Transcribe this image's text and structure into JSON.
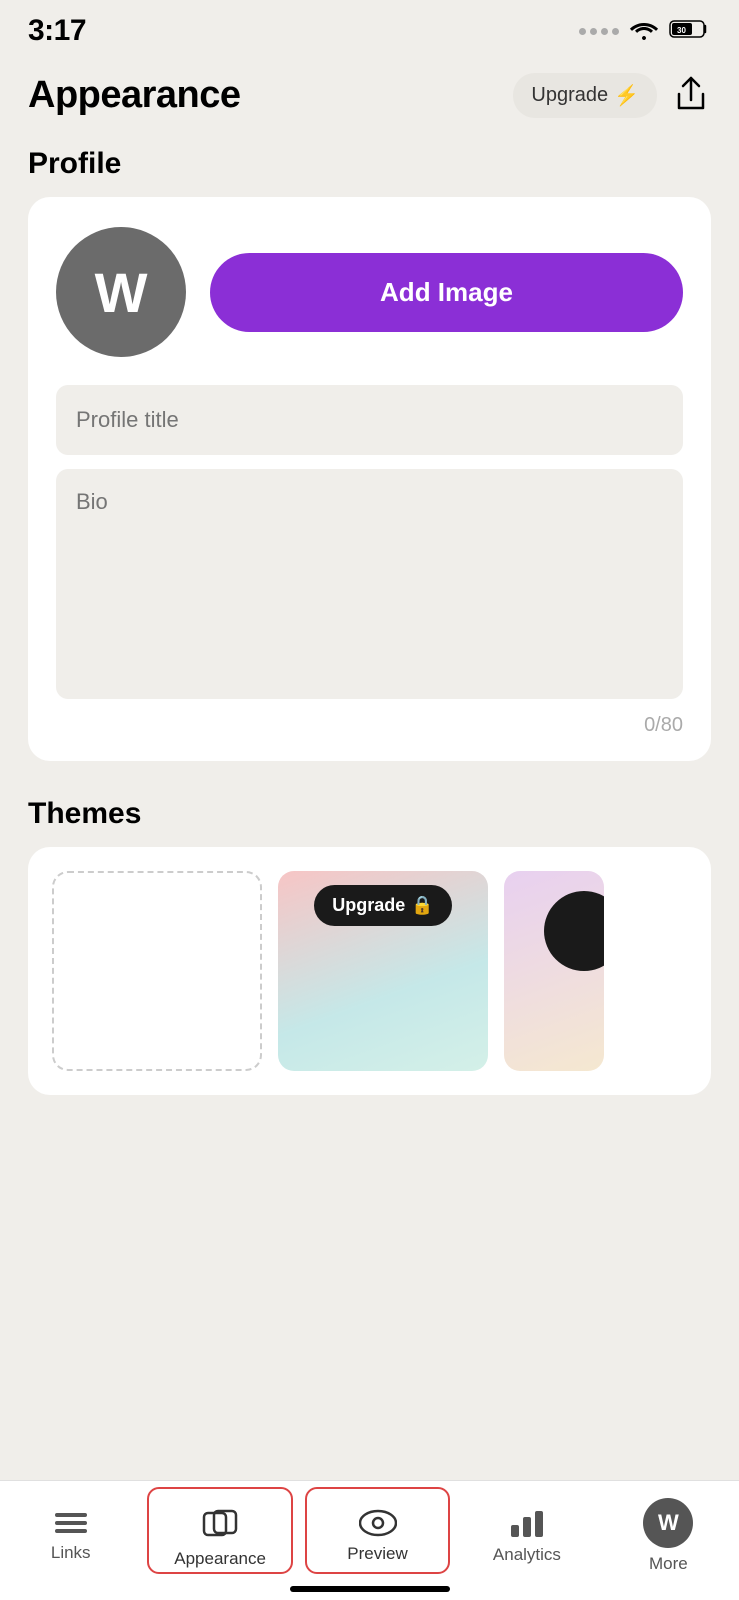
{
  "statusBar": {
    "time": "3:17"
  },
  "header": {
    "title": "Appearance",
    "upgradeLabel": "Upgrade",
    "upgradeIcon": "⚡"
  },
  "profile": {
    "sectionTitle": "Profile",
    "avatarLetter": "W",
    "addImageLabel": "Add Image",
    "profileTitlePlaceholder": "Profile title",
    "bioPlaceholder": "Bio",
    "bioCounter": "0/80"
  },
  "themes": {
    "sectionTitle": "Themes",
    "upgradeBadgeLabel": "Upgrade",
    "upgradeBadgeIcon": "🔒"
  },
  "bottomNav": {
    "links": "Links",
    "appearance": "Appearance",
    "preview": "Preview",
    "analytics": "Analytics",
    "more": "More",
    "moreAvatarLetter": "W"
  }
}
